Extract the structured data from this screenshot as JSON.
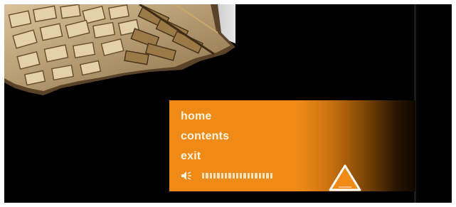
{
  "menu": {
    "items": [
      {
        "label": "home"
      },
      {
        "label": "contents"
      },
      {
        "label": "exit"
      }
    ]
  },
  "volume": {
    "level": 1.0,
    "segments": 19
  },
  "icons": {
    "speaker": "speaker-icon",
    "up": "triangle-up-icon"
  },
  "colors": {
    "accent": "#ef8a17",
    "background": "#000000",
    "menu_text": "#fff4e0"
  }
}
